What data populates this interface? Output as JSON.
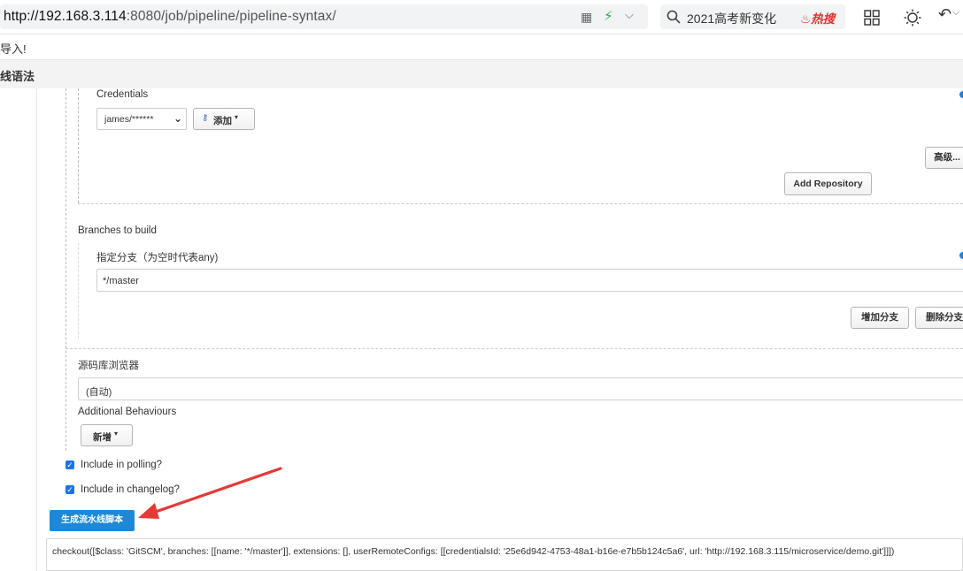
{
  "browser": {
    "url_host": "http://192.168.3.114",
    "url_rest": ":8080/job/pipeline/pipeline-syntax/",
    "search_text": "2021高考新变化",
    "hot_badge": "热搜"
  },
  "page": {
    "message": "导入!",
    "header_title": "线语法"
  },
  "credentials": {
    "label": "Credentials",
    "selected": "james/******",
    "add_label": "添加"
  },
  "buttons": {
    "advanced": "高级...",
    "add_repository": "Add Repository",
    "add_branch": "增加分支",
    "delete_branch": "删除分支",
    "new": "新增",
    "generate": "生成流水线脚本"
  },
  "branches": {
    "section_label": "Branches to build",
    "spec_label": "指定分支（为空时代表any)",
    "spec_value": "*/master"
  },
  "browser_section": {
    "label": "源码库浏览器",
    "value": "(自动)"
  },
  "behaviours": {
    "label": "Additional Behaviours"
  },
  "options": {
    "polling_label": "Include in polling?",
    "polling_checked": true,
    "changelog_label": "Include in changelog?",
    "changelog_checked": true
  },
  "output": {
    "script": "checkout([$class: 'GitSCM', branches: [[name: '*/master']], extensions: [], userRemoteConfigs: [[credentialsId: '25e6d942-4753-48a1-b16e-e7b5b124c5a6', url: 'http://192.168.3.115/microservice/demo.git']]])"
  },
  "colors": {
    "accent": "#1e88d8",
    "arrow": "#e53935",
    "hot": "#e5302b"
  }
}
